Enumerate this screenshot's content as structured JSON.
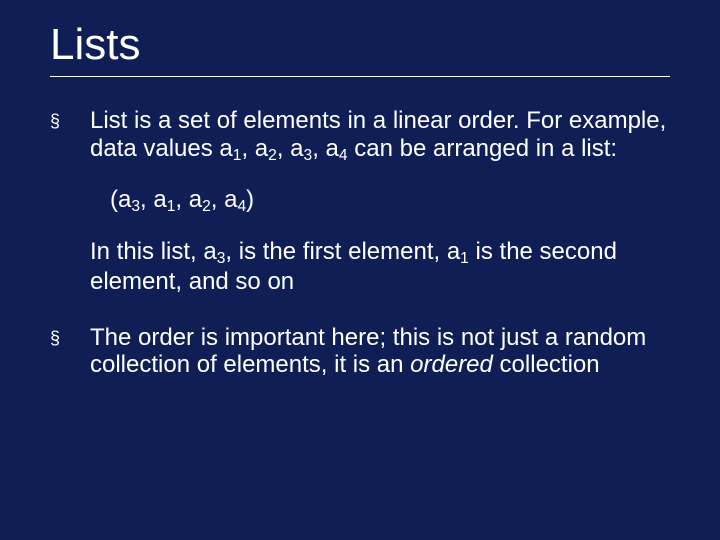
{
  "title": "Lists",
  "bullet_marker": "§",
  "items": [
    {
      "p1_a": "List is a set of elements in a linear order. For example, data values a",
      "p1_b": ", a",
      "p1_c": ", a",
      "p1_d": ", a",
      "p1_e": " can be arranged in a list:",
      "s1": "1",
      "s2": "2",
      "s3": "3",
      "s4": "4",
      "ex_a": "(a",
      "ex_b": ", a",
      "ex_c": ", a",
      "ex_d": ", a",
      "ex_e": ")",
      "es1": "3",
      "es2": "1",
      "es3": "2",
      "es4": "4",
      "p2_a": "In this list, a",
      "p2_b": ", is the first element, a",
      "p2_c": " is the second element, and so on",
      "ps1": "3",
      "ps2": "1"
    },
    {
      "t_a": "The order is important here; this is not just a random collection of elements, it is an ",
      "t_b": "ordered",
      "t_c": " collection"
    }
  ]
}
